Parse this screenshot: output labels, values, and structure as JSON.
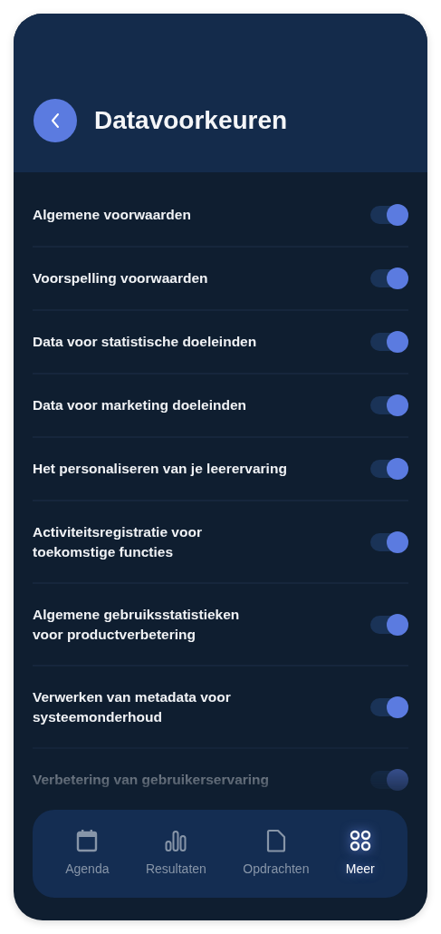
{
  "header": {
    "title": "Datavoorkeuren"
  },
  "settings": [
    {
      "label": "Algemene voorwaarden",
      "on": true
    },
    {
      "label": "Voorspelling voorwaarden",
      "on": true
    },
    {
      "label": "Data voor statistische doeleinden",
      "on": true
    },
    {
      "label": "Data voor marketing doeleinden",
      "on": true
    },
    {
      "label": "Het personaliseren van je leerervaring",
      "on": true
    },
    {
      "label": "Activiteitsregistratie voor\ntoekomstige functies",
      "on": true
    },
    {
      "label": "Algemene gebruiksstatistieken\nvoor productverbetering",
      "on": true
    },
    {
      "label": "Verwerken van metadata voor\nsysteemonderhoud",
      "on": true
    },
    {
      "label": "Verbetering van gebruikerservaring",
      "on": true
    }
  ],
  "nav": [
    {
      "label": "Agenda",
      "kind": "calendar",
      "selected": false
    },
    {
      "label": "Resultaten",
      "kind": "chart",
      "selected": false
    },
    {
      "label": "Opdrachten",
      "kind": "document",
      "selected": false
    },
    {
      "label": "Meer",
      "kind": "more",
      "selected": true
    }
  ]
}
